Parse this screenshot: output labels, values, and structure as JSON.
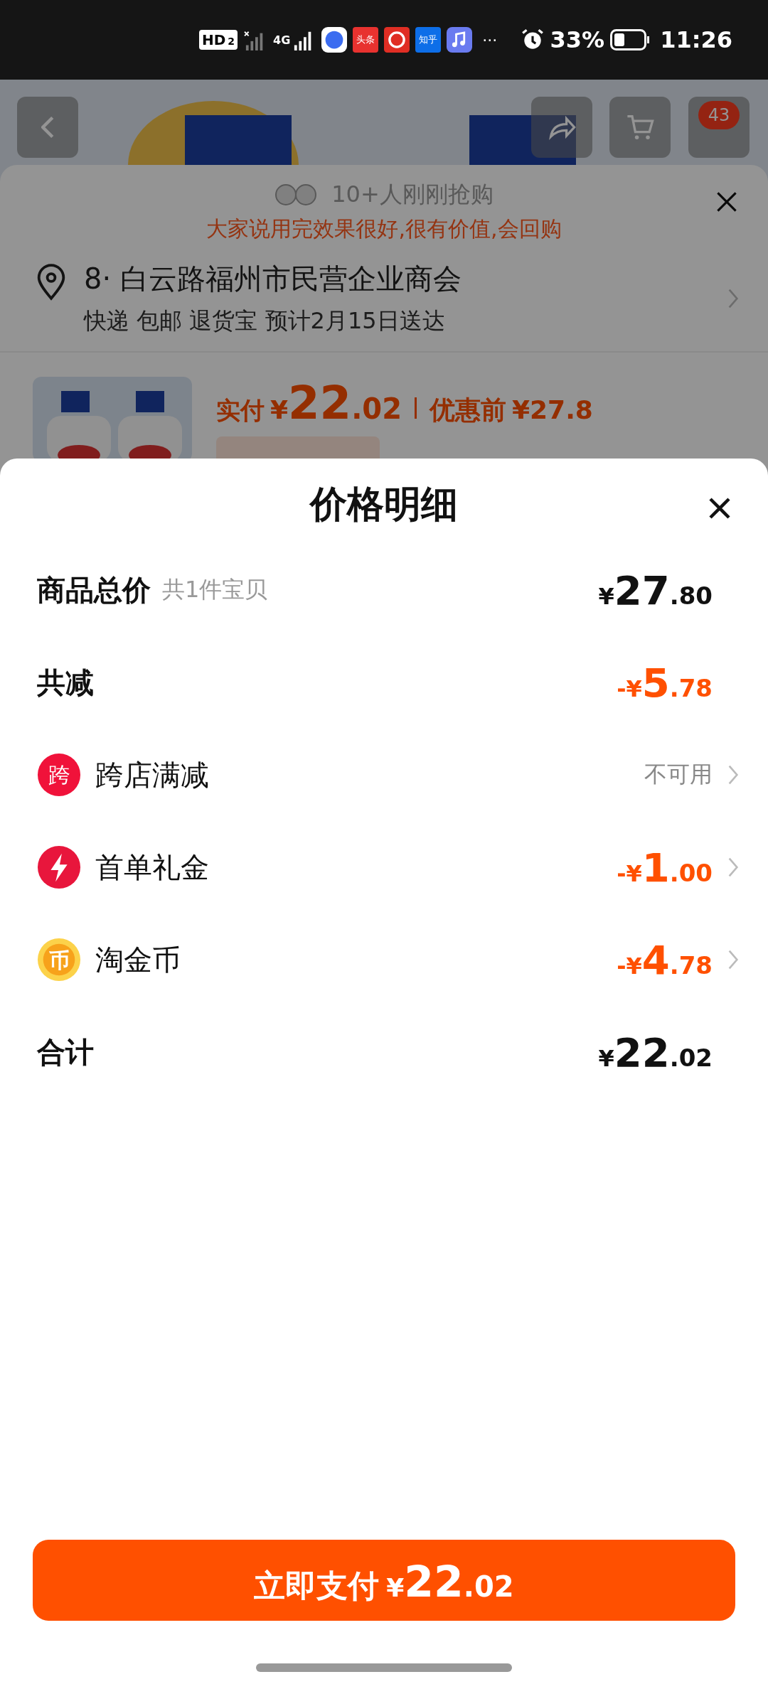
{
  "status_bar": {
    "hd": "HD",
    "sim": "2",
    "network": "4G",
    "apps": [
      {
        "kind": "browser",
        "color": "#3b6cf0"
      },
      {
        "kind": "label",
        "text": "头条",
        "color": "#e8322f"
      },
      {
        "kind": "gift",
        "color": "#e02e24"
      },
      {
        "kind": "label",
        "text": "知乎",
        "color": "#0d6ee8"
      },
      {
        "kind": "music",
        "color": "#6a7bf0"
      }
    ],
    "more": "···",
    "battery_text": "33%",
    "time": "11:26"
  },
  "nav": {
    "badge": "43"
  },
  "purchase_panel": {
    "buyers": "10+人刚刚抢购",
    "review": "大家说用完效果很好,很有价值,会回购",
    "address": "8· 白云路福州市民营企业商会",
    "delivery": "快递 包邮 退货宝 预计2月15日送达",
    "paid_label": "实付",
    "paid": {
      "currency": "¥",
      "integer": "22",
      "decimal": ".02"
    },
    "original_label": "优惠前",
    "original": "¥27.8"
  },
  "price_detail": {
    "title": "价格明细",
    "rows": [
      {
        "kind": "heading",
        "label": "商品总价",
        "note": "共1件宝贝",
        "price": {
          "currency": "¥",
          "integer": "27",
          "decimal": ".80"
        }
      },
      {
        "kind": "heading",
        "label": "共减",
        "price": {
          "sign": "-",
          "currency": "¥",
          "integer": "5",
          "decimal": ".78"
        }
      },
      {
        "kind": "store",
        "badge": "跨",
        "label": "跨店满减",
        "status": "不可用"
      },
      {
        "kind": "bolt",
        "label": "首单礼金",
        "price": {
          "sign": "-",
          "currency": "¥",
          "integer": "1",
          "decimal": ".00"
        }
      },
      {
        "kind": "coin",
        "badge": "币",
        "label": "淘金币",
        "price": {
          "sign": "-",
          "currency": "¥",
          "integer": "4",
          "decimal": ".78"
        }
      },
      {
        "kind": "heading",
        "label": "合计",
        "price": {
          "currency": "¥",
          "integer": "22",
          "decimal": ".02"
        }
      }
    ]
  },
  "pay_button": {
    "label": "立即支付",
    "price": {
      "currency": "¥",
      "integer": "22",
      "decimal": ".02"
    }
  }
}
